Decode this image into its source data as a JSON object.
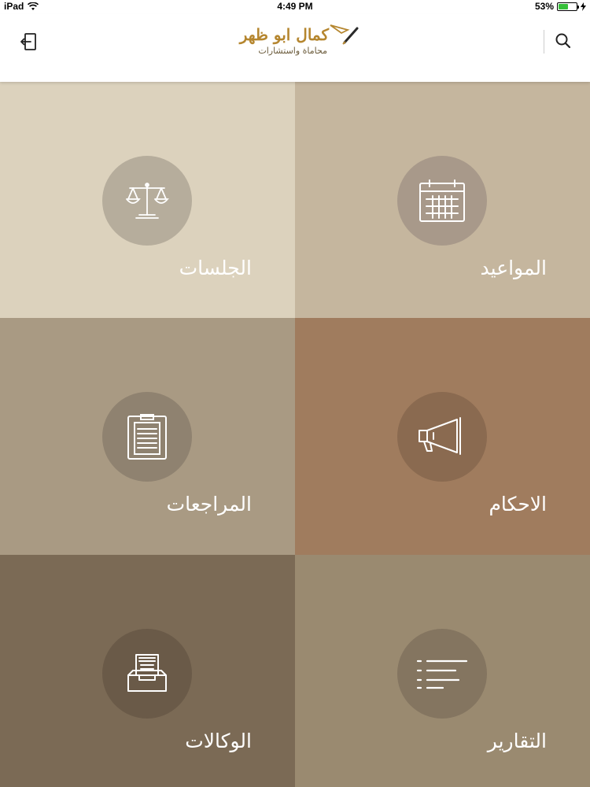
{
  "status_bar": {
    "device": "iPad",
    "time": "4:49 PM",
    "battery": "53%",
    "battery_level": 0.53
  },
  "header": {
    "logo_title": "كمال ابو ظهر",
    "logo_subtitle": "محاماة واستشارات",
    "logout_icon": "logout-icon",
    "search_icon": "search-icon"
  },
  "tiles": [
    {
      "label": "الجلسات",
      "icon": "scales-icon",
      "bg": "#dcd2bd",
      "circle": "#b6ad9c"
    },
    {
      "label": "المواعيد",
      "icon": "calendar-icon",
      "bg": "#c5b69e",
      "circle": "#a8998a"
    },
    {
      "label": "المراجعات",
      "icon": "clipboard-icon",
      "bg": "#a99a83",
      "circle": "#8f8270"
    },
    {
      "label": "الاحكام",
      "icon": "megaphone-icon",
      "bg": "#a07c5e",
      "circle": "#8a6a50"
    },
    {
      "label": "الوكالات",
      "icon": "inbox-tray-icon",
      "bg": "#7b6a55",
      "circle": "#6a5a48"
    },
    {
      "label": "التقارير",
      "icon": "list-icon",
      "bg": "#9a8a70",
      "circle": "#847560"
    }
  ]
}
